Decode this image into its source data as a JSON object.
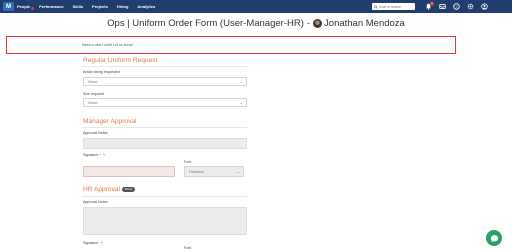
{
  "nav": {
    "logo": "M",
    "items": [
      "People",
      "Performance",
      "Skills",
      "Projects",
      "Hiring",
      "Analytics"
    ],
    "active_index": 0
  },
  "search": {
    "placeholder": "Chat or search"
  },
  "notifications": {
    "badge_count": "1"
  },
  "title": {
    "form_title": "Ops | Uniform Order Form (User-Manager-HR)",
    "separator": "-",
    "user_name": "Jonathan Mendoza"
  },
  "message": "Need a new t shirt! Let us know!",
  "regular": {
    "heading": "Regular Uniform Request",
    "article_label": "Article being requested",
    "article_value": "Select",
    "size_label": "Size required",
    "size_value": "Select"
  },
  "manager": {
    "heading": "Manager Approval",
    "notes_label": "Approval Notes",
    "signature_label": "Signature",
    "required_mark": "*",
    "font_label": "Font",
    "font_value": "Freehand"
  },
  "hr": {
    "heading": "HR Approval",
    "pill": "Done",
    "notes_label": "Approval Notes",
    "signature_label": "Signature",
    "font_label": "Font"
  },
  "colors": {
    "nav_bg": "#1f3e6e",
    "accent": "#e07a4a",
    "highlight": "#e53935",
    "chat": "#26a269"
  }
}
